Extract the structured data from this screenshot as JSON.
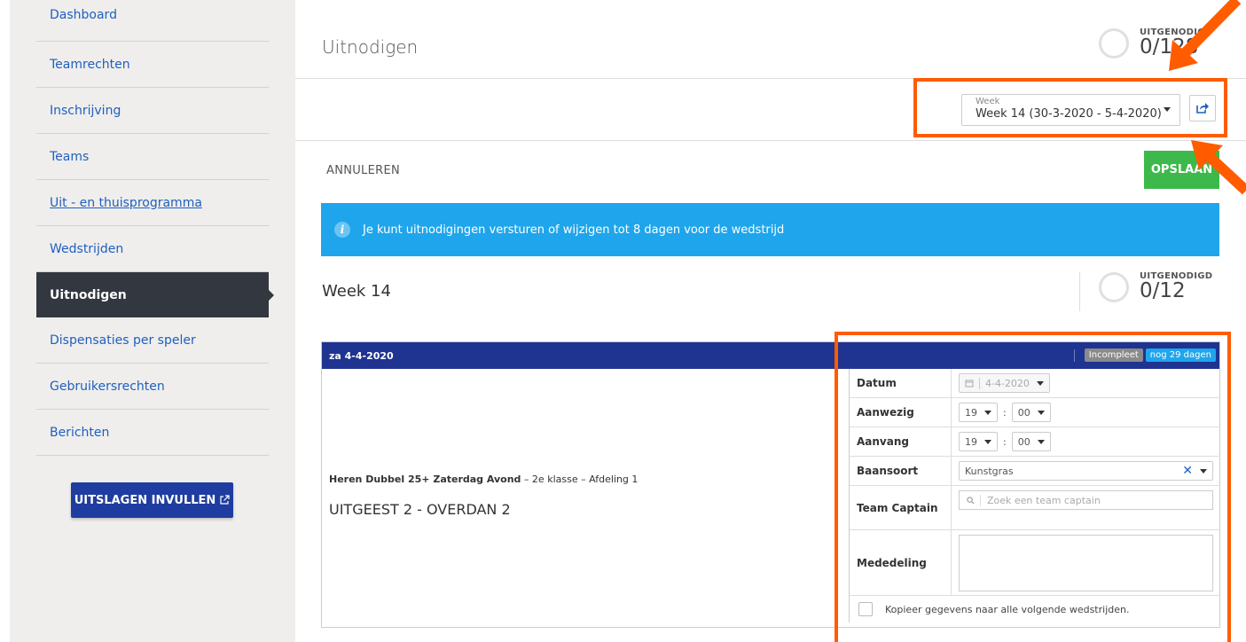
{
  "sidebar": {
    "items": [
      {
        "label": "Dashboard"
      },
      {
        "label": "Teamrechten"
      },
      {
        "label": "Inschrijving"
      },
      {
        "label": "Teams"
      },
      {
        "label": "Uit - en thuisprogramma"
      },
      {
        "label": "Wedstrijden"
      },
      {
        "label": "Uitnodigen"
      },
      {
        "label": "Dispensaties per speler"
      },
      {
        "label": "Gebruikersrechten"
      },
      {
        "label": "Berichten"
      }
    ],
    "action_button": "UITSLAGEN INVULLEN"
  },
  "header": {
    "title": "Uitnodigen",
    "counter_label": "UITGENODIGD",
    "counter_value": "0/128"
  },
  "toolbar": {
    "week_label": "Week",
    "week_value": "Week 14 (30-3-2020 - 5-4-2020)"
  },
  "actions": {
    "cancel": "ANNULEREN",
    "save": "OPSLAAN"
  },
  "info": {
    "icon": "i",
    "text": "Je kunt uitnodigingen versturen of wijzigen tot 8 dagen voor de wedstrijd"
  },
  "week_section": {
    "title": "Week 14",
    "counter_label": "UITGENODIGD",
    "counter_value": "0/12"
  },
  "match": {
    "date": "za 4-4-2020",
    "badge_status": "Incompleet",
    "badge_days": "nog 29 dagen",
    "competition_bold": "Heren Dubbel 25+ Zaterdag Avond",
    "competition_rest": " – 2e klasse – Afdeling 1",
    "teams": "UITGEEST 2 - OVERDAN 2",
    "form": {
      "datum_label": "Datum",
      "datum_value": "4-4-2020",
      "aanwezig_label": "Aanwezig",
      "aanwezig_hour": "19",
      "aanwezig_min": "00",
      "aanvang_label": "Aanvang",
      "aanvang_hour": "19",
      "aanvang_min": "00",
      "baansoort_label": "Baansoort",
      "baansoort_value": "Kunstgras",
      "captain_label": "Team Captain",
      "captain_placeholder": "Zoek een team captain",
      "mededeling_label": "Mededeling",
      "copy_label": "Kopieer gegevens naar alle volgende wedstrijden."
    }
  },
  "colors": {
    "accent_blue": "#1f5fbf",
    "header_navy": "#1f3390",
    "save_green": "#3cb94a",
    "info_blue": "#1fa5eb",
    "highlight_orange": "#ff5c00"
  }
}
